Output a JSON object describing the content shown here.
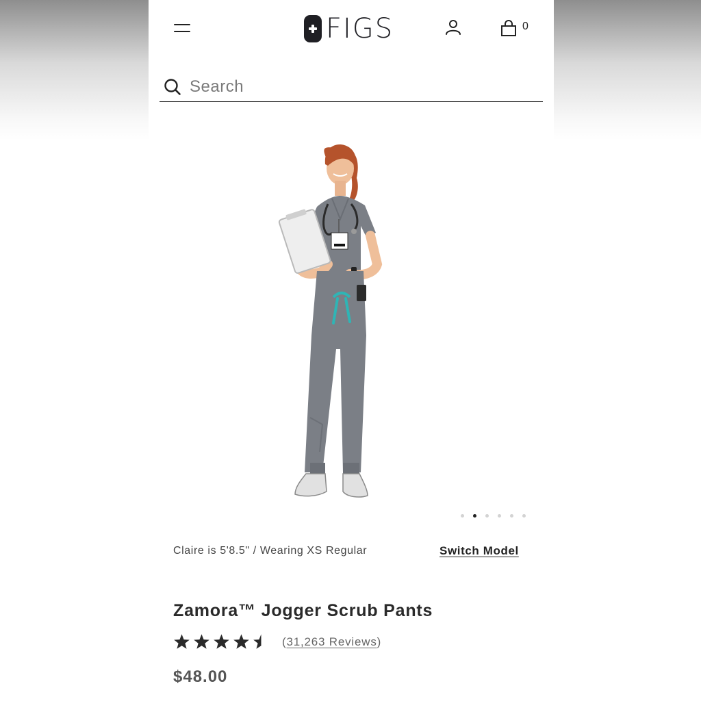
{
  "header": {
    "logo_text": "FIGS",
    "cart_count": "0"
  },
  "search": {
    "placeholder": "Search"
  },
  "gallery": {
    "dot_count": 6,
    "active_index": 1,
    "model_info": "Claire is 5'8.5\" / Wearing XS Regular",
    "switch_model_label": "Switch Model"
  },
  "product": {
    "title": "Zamora™ Jogger Scrub Pants",
    "rating": 4.5,
    "reviews_prefix": "(",
    "reviews_count_text": "31,263 Reviews",
    "reviews_suffix": ")",
    "price": "$48.00"
  },
  "colors": {
    "scrub_gray": "#7b7f86",
    "drawstring_teal": "#2fb5b5",
    "hair": "#b5532c",
    "skin": "#efbf9a",
    "text_dark": "#222222"
  }
}
